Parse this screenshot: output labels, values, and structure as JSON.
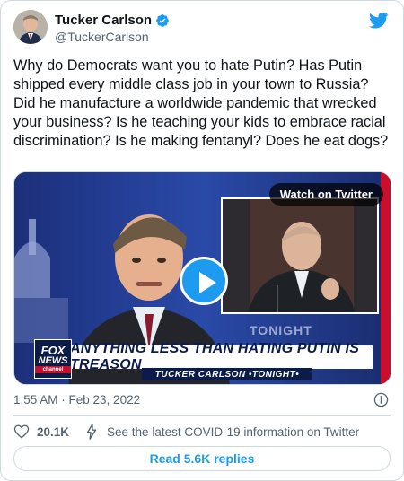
{
  "author": {
    "name": "Tucker Carlson",
    "handle": "@TuckerCarlson",
    "verified": true,
    "avatar_icon": "avatar-photo"
  },
  "brand": {
    "logo_icon": "twitter-bird-icon",
    "accent_color": "#1d9bf0"
  },
  "tweet": {
    "text": "Why do Democrats want you to hate Putin? Has Putin shipped every middle class job in your town to Russia? Did he manufacture a worldwide pandemic that wrecked your business? Is he teaching your kids to embrace racial discrimination? Is he making fentanyl? Does he eat dogs?",
    "timestamp": "1:55 AM · Feb 23, 2022"
  },
  "media": {
    "watch_label": "Watch on Twitter",
    "play_icon": "play-icon",
    "chyron": "ANYTHING LESS THAN HATING PUTIN IS TREASON",
    "show_strip": "TUCKER CARLSON •TONIGHT•",
    "network_logo_line1": "FOX",
    "network_logo_line2": "NEWS",
    "network_logo_line3": "channel",
    "background_word": "TONIGHT"
  },
  "actions": {
    "like_icon": "heart-icon",
    "like_count": "20.1K",
    "covid_icon": "lightning-icon",
    "covid_text": "See the latest COVID-19 information on Twitter",
    "info_icon": "info-icon"
  },
  "replies_button": {
    "label": "Read 5.6K replies"
  }
}
